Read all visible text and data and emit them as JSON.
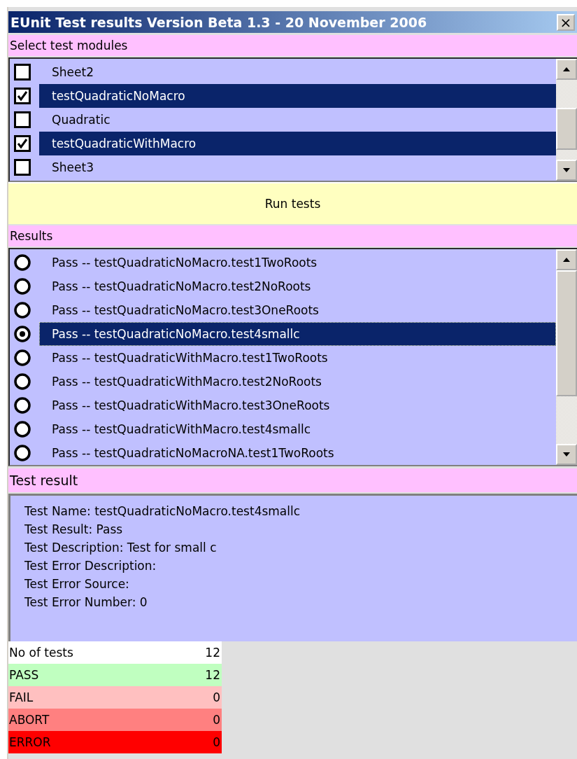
{
  "window": {
    "title": "EUnit Test results Version Beta 1.3 - 20 November 2006",
    "close": "×"
  },
  "modules": {
    "label": "Select test modules",
    "items": [
      {
        "name": "Sheet2",
        "checked": false,
        "selected": false
      },
      {
        "name": "testQuadraticNoMacro",
        "checked": true,
        "selected": true
      },
      {
        "name": "Quadratic",
        "checked": false,
        "selected": false
      },
      {
        "name": "testQuadraticWithMacro",
        "checked": true,
        "selected": true
      },
      {
        "name": "Sheet3",
        "checked": false,
        "selected": false
      }
    ]
  },
  "run_button": "Run tests",
  "results": {
    "label": "Results",
    "items": [
      {
        "text": "Pass -- testQuadraticNoMacro.test1TwoRoots",
        "selected": false
      },
      {
        "text": "Pass -- testQuadraticNoMacro.test2NoRoots",
        "selected": false
      },
      {
        "text": "Pass -- testQuadraticNoMacro.test3OneRoots",
        "selected": false
      },
      {
        "text": "Pass -- testQuadraticNoMacro.test4smallc",
        "selected": true
      },
      {
        "text": "Pass -- testQuadraticWithMacro.test1TwoRoots",
        "selected": false
      },
      {
        "text": "Pass -- testQuadraticWithMacro.test2NoRoots",
        "selected": false
      },
      {
        "text": "Pass -- testQuadraticWithMacro.test3OneRoots",
        "selected": false
      },
      {
        "text": "Pass -- testQuadraticWithMacro.test4smallc",
        "selected": false
      },
      {
        "text": "Pass -- testQuadraticNoMacroNA.test1TwoRoots",
        "selected": false
      }
    ]
  },
  "test_result": {
    "label": "Test result",
    "lines": [
      "Test Name: testQuadraticNoMacro.test4smallc",
      "Test Result: Pass",
      "Test Description: Test for small c",
      "Test Error Description:",
      "Test Error Source:",
      "Test Error Number: 0"
    ]
  },
  "summary": [
    {
      "label": "No of tests",
      "value": "12",
      "color": "#ffffff"
    },
    {
      "label": "PASS",
      "value": "12",
      "color": "#c0ffc0"
    },
    {
      "label": "FAIL",
      "value": "0",
      "color": "#ffc0c0"
    },
    {
      "label": "ABORT",
      "value": "0",
      "color": "#ff8080"
    },
    {
      "label": "ERROR",
      "value": "0",
      "color": "#ff0000"
    }
  ]
}
